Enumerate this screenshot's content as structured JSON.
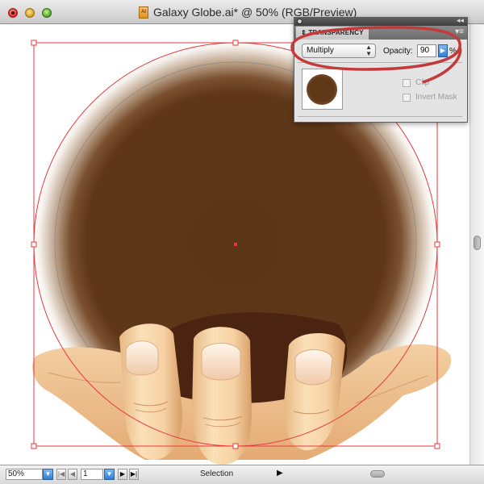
{
  "window": {
    "title": "Galaxy Globe.ai* @ 50% (RGB/Preview)",
    "doc_icon_text": "AI"
  },
  "panel": {
    "tab_label": "TRANSPARENCY",
    "blend_mode": "Multiply",
    "opacity_label": "Opacity:",
    "opacity_value": "90",
    "opacity_unit": "%",
    "clip_label": "Clip",
    "invert_mask_label": "Invert Mask",
    "clip_checked": false,
    "invert_mask_checked": false
  },
  "status": {
    "zoom": "50%",
    "page": "1",
    "current_tool": "Selection"
  },
  "icons": {
    "close": "close-icon",
    "minimize": "minimize-icon",
    "zoom": "zoom-icon",
    "panel_menu": "panel-menu-icon",
    "dropdown": "chevron-down-icon",
    "stepper": "chevron-right-icon"
  },
  "colors": {
    "selection": "#e8383b",
    "artwork_brown": "#5c3416",
    "skin": "#f1c898",
    "annotation_oval": "#c43a3a",
    "accent_blue": "#2f7fd6"
  }
}
